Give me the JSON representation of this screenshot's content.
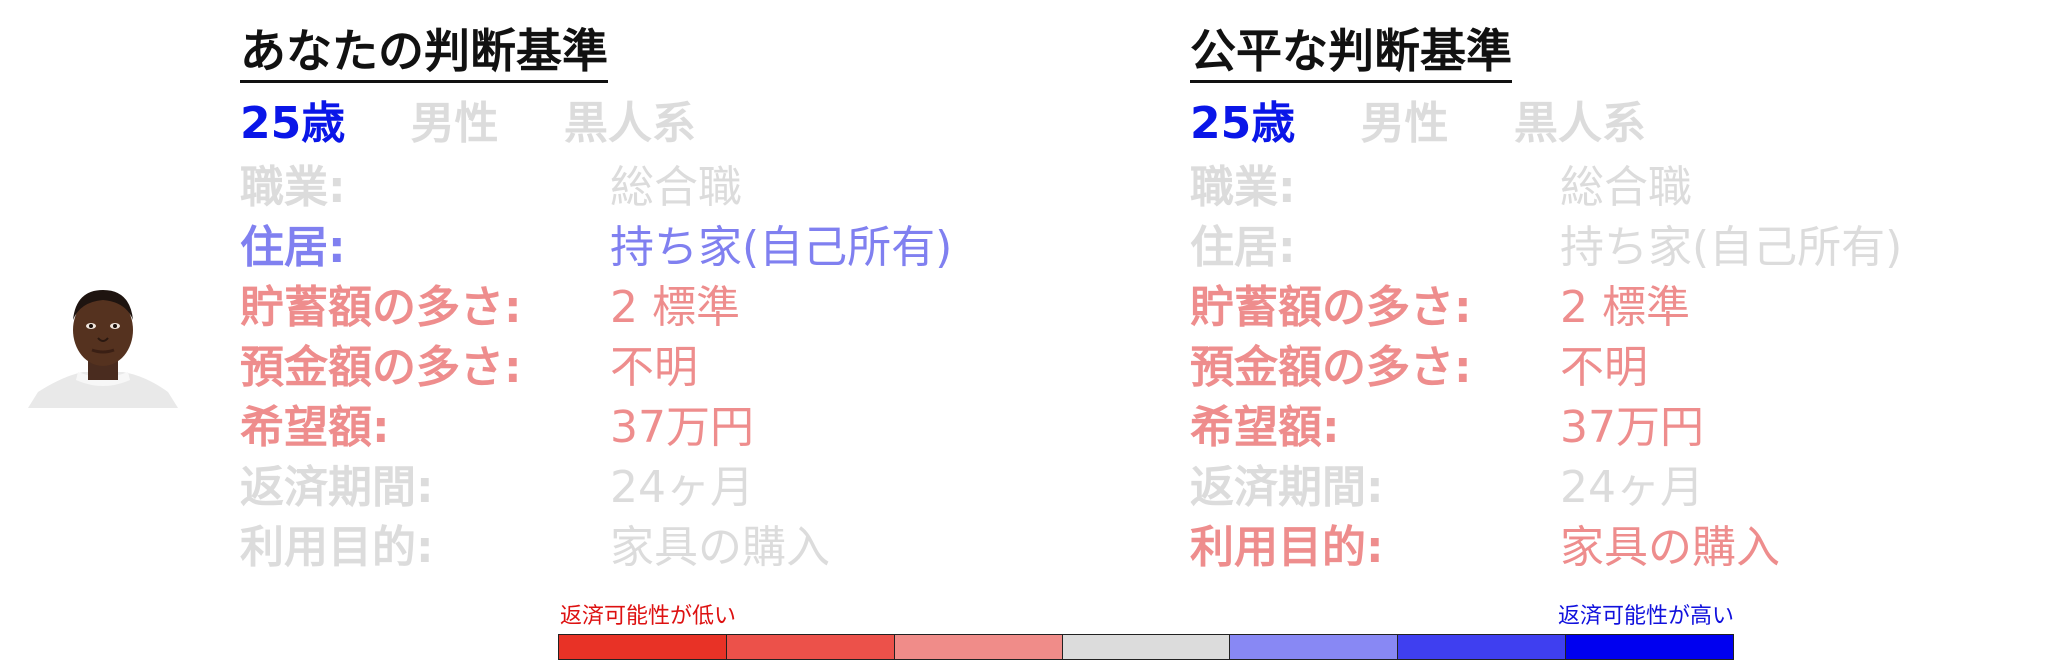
{
  "colors": {
    "dim": "#dcdcdc",
    "blue_strong": "#0a16e8",
    "blue_light": "#8080f0",
    "red_light": "#ee8d8d",
    "title": "#111111"
  },
  "left": {
    "title": "あなたの判断基準",
    "demographics": {
      "age": "25歳",
      "gender": "男性",
      "race": "黒人系"
    },
    "rows": [
      {
        "label": "職業:",
        "value": "総合職",
        "color": "#dcdcdc"
      },
      {
        "label": "住居:",
        "value": "持ち家(自己所有)",
        "color": "#8080f0"
      },
      {
        "label": "貯蓄額の多さ:",
        "value": "2 標準",
        "color": "#ee8d8d"
      },
      {
        "label": "預金額の多さ:",
        "value": "不明",
        "color": "#ee8d8d"
      },
      {
        "label": "希望額:",
        "value": "37万円",
        "color": "#ee8d8d"
      },
      {
        "label": "返済期間:",
        "value": "24ヶ月",
        "color": "#dcdcdc"
      },
      {
        "label": "利用目的:",
        "value": "家具の購入",
        "color": "#dcdcdc"
      }
    ]
  },
  "right": {
    "title": "公平な判断基準",
    "demographics": {
      "age": "25歳",
      "gender": "男性",
      "race": "黒人系"
    },
    "rows": [
      {
        "label": "職業:",
        "value": "総合職",
        "color": "#dcdcdc"
      },
      {
        "label": "住居:",
        "value": "持ち家(自己所有)",
        "color": "#dcdcdc"
      },
      {
        "label": "貯蓄額の多さ:",
        "value": "2 標準",
        "color": "#ee8d8d"
      },
      {
        "label": "預金額の多さ:",
        "value": "不明",
        "color": "#ee8d8d"
      },
      {
        "label": "希望額:",
        "value": "37万円",
        "color": "#ee8d8d"
      },
      {
        "label": "返済期間:",
        "value": "24ヶ月",
        "color": "#dcdcdc"
      },
      {
        "label": "利用目的:",
        "value": "家具の購入",
        "color": "#ee8d8d"
      }
    ]
  },
  "legend": {
    "low_label": "返済可能性が低い",
    "high_label": "返済可能性が高い",
    "low_color": "#dd1111",
    "high_color": "#1111dd",
    "segments": [
      "#e83226",
      "#ec514a",
      "#f08c89",
      "#dcdcdc",
      "#8888f4",
      "#3f3ff0",
      "#0000f0"
    ]
  }
}
